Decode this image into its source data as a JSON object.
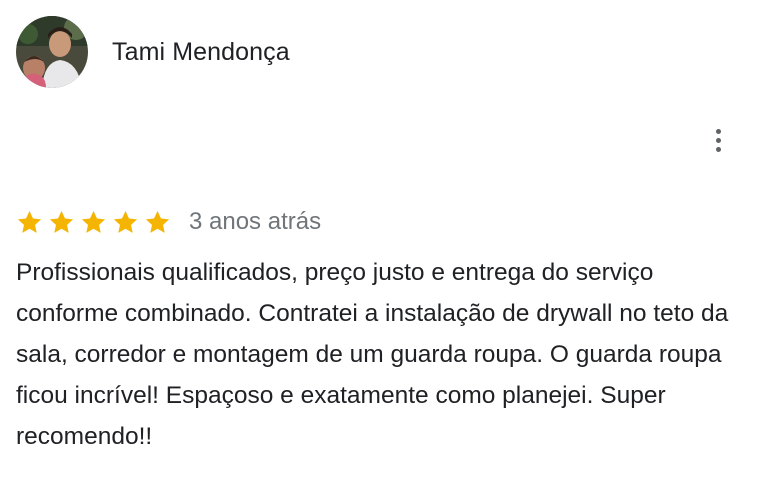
{
  "reviewer": {
    "name": "Tami Mendonça",
    "avatar_icon": "profile-photo"
  },
  "menu": {
    "icon": "more-vert-icon"
  },
  "rating": {
    "stars": 5,
    "max_stars": 5,
    "star_color": "#f4b400",
    "date": "3 anos atrás"
  },
  "review": {
    "text": "Profissionais qualificados, preço justo e entrega do serviço conforme combinado. Contratei a instalação de drywall no teto da sala, corredor e montagem de um guarda roupa. O guarda roupa ficou incrível! Espaçoso e exatamente como planejei. Super recomendo!!"
  },
  "colors": {
    "text_primary": "#202124",
    "text_secondary": "#70757a",
    "icon_gray": "#5f6368"
  }
}
